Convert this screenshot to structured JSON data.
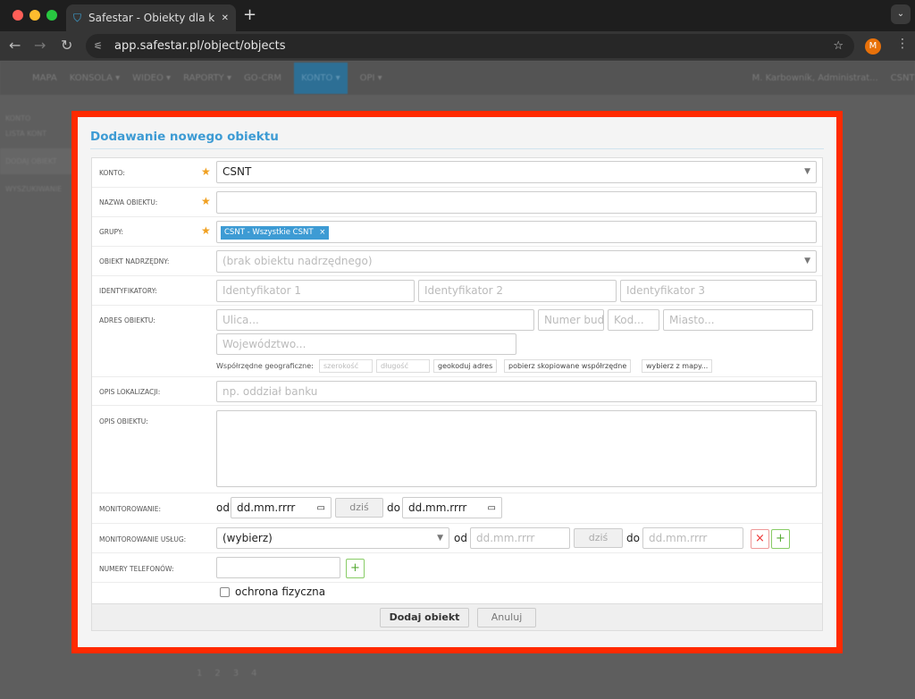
{
  "browser": {
    "tab_title": "Safestar - Obiekty dla konta CSNT",
    "url": "app.safestar.pl/object/objects",
    "avatar": "M",
    "new_tab": "+",
    "close": "✕"
  },
  "app_nav": {
    "items": [
      "MAPA",
      "KONSOLA ▾",
      "WIDEO ▾",
      "RAPORTY ▾",
      "GO-CRM",
      "KONTO ▾",
      "OPI ▾"
    ],
    "user": "M. Karbowník, Administrat...",
    "user_account": "CSNT"
  },
  "background": {
    "left": [
      "KONTO",
      "LISTA KONT",
      "DODAJ OBIEKT",
      "WYSZUKIWANIE"
    ],
    "pages": [
      "1",
      "2",
      "3",
      "4"
    ]
  },
  "dialog": {
    "title": "Dodawanie nowego obiektu",
    "konto": {
      "label": "KONTO:",
      "value": "CSNT"
    },
    "nazwa": {
      "label": "NAZWA OBIEKTU:",
      "value": ""
    },
    "grupy": {
      "label": "GRUPY:",
      "tag": "CSNT - Wszystkie CSNT",
      "tag_remove": "×"
    },
    "nadrzedny": {
      "label": "OBIEKT NADRZĘDNY:",
      "placeholder": "(brak obiektu nadrzędnego)"
    },
    "identyfikatory": {
      "label": "IDENTYFIKATORY:",
      "placeholders": [
        "Identyfikator 1",
        "Identyfikator 2",
        "Identyfikator 3"
      ]
    },
    "adres": {
      "label": "ADRES OBIEKTU:",
      "ulica": "Ulica...",
      "numer": "Numer bud",
      "kod": "Kod...",
      "miasto": "Miasto...",
      "wojewodztwo": "Województwo...",
      "geo_label": "Współrzędne geograficzne:",
      "szerokosc": "szerokość",
      "dlugosc": "długość",
      "geokoduj": "geokoduj adres",
      "pobierz": "pobierz skopiowane współrzędne",
      "wybierz": "wybierz z mapy..."
    },
    "opis_lok": {
      "label": "OPIS LOKALIZACJI:",
      "placeholder": "np. oddział banku"
    },
    "opis_obj": {
      "label": "OPIS OBIEKTU:"
    },
    "monitorowanie": {
      "label": "MONITOROWANIE:",
      "od": "od",
      "do": "do",
      "date_from": "dd.mm.rrrr",
      "date_to": "dd.mm.rrrr",
      "today": "dziś"
    },
    "uslugi": {
      "label": "MONITOROWANIE USŁUG:",
      "select": "(wybierz)",
      "od": "od",
      "do": "do",
      "date_from": "dd.mm.rrrr",
      "date_to": "dd.mm.rrrr",
      "today": "dziś",
      "remove": "×",
      "add": "+"
    },
    "telefony": {
      "label": "NUMERY TELEFONÓW:",
      "add": "+"
    },
    "ochrona": {
      "label": "ochrona fizyczna",
      "checked": false
    },
    "submit": "Dodaj obiekt",
    "cancel": "Anuluj"
  },
  "colors": {
    "highlight_frame": "#ff2a00",
    "title": "#3d9bd4",
    "tag": "#3d9bd4",
    "required": "#f0a020"
  }
}
